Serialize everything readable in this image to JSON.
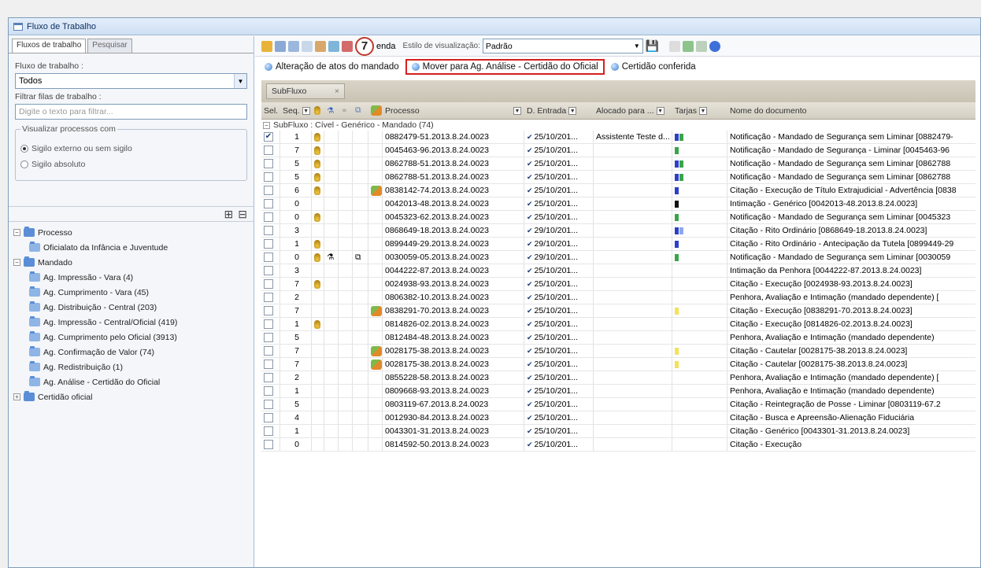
{
  "window": {
    "title": "Fluxo de Trabalho"
  },
  "left": {
    "tabs": [
      "Fluxos de trabalho",
      "Pesquisar"
    ],
    "fluxo_label": "Fluxo de trabalho :",
    "fluxo_value": "Todos",
    "filtrar_label": "Filtrar filas de trabalho :",
    "filtrar_placeholder": "Digite o texto para filtrar...",
    "visualizar_label": "Visualizar processos com",
    "radio_1": "Sigilo externo ou sem sigilo",
    "radio_2": "Sigilo absoluto",
    "tree": [
      {
        "label": "Processo",
        "level": 0,
        "expander": "−"
      },
      {
        "label": "Oficialato da Infância e Juventude",
        "level": 1
      },
      {
        "label": "Mandado",
        "level": 0,
        "expander": "−"
      },
      {
        "label": "Ag. Impressão - Vara (4)",
        "level": 1
      },
      {
        "label": "Ag. Cumprimento - Vara (45)",
        "level": 1
      },
      {
        "label": "Ag. Distribuição - Central (203)",
        "level": 1
      },
      {
        "label": "Ag. Impressão - Central/Oficial (419)",
        "level": 1
      },
      {
        "label": "Ag. Cumprimento pelo Oficial (3913)",
        "level": 1
      },
      {
        "label": "Ag. Confirmação de Valor (74)",
        "level": 1
      },
      {
        "label": "Ag. Redistribuição (1)",
        "level": 1
      },
      {
        "label": "Ag. Análise - Certidão do Oficial",
        "level": 1
      },
      {
        "label": "Certidão oficial",
        "level": 0,
        "expander": "+"
      }
    ]
  },
  "toolbar": {
    "step_badge": "7",
    "partial_label": "enda",
    "estilo_label": "Estilo de visualização:",
    "estilo_value": "Padrão"
  },
  "actions": [
    {
      "label": "Alteração de atos do mandado"
    },
    {
      "label": "Mover para Ag. Análise - Certidão do Oficial",
      "highlight": true
    },
    {
      "label": "Certidão conferida"
    }
  ],
  "subfluxo_chip": "SubFluxo",
  "columns": {
    "sel": "Sel.",
    "seq": "Seq.",
    "processo": "Processo",
    "entrada": "D. Entrada",
    "alocado": "Alocado para ...",
    "tarjas": "Tarjas",
    "documento": "Nome do documento"
  },
  "group_label": "SubFluxo : Cível - Genérico - Mandado (74)",
  "tag_colors": {
    "blue": "#2b3fc8",
    "green": "#3aa44a",
    "black": "#111111",
    "yellow": "#f3e25a",
    "lightblue": "#8da6f0"
  },
  "rows": [
    {
      "checked": true,
      "seq": "1",
      "bug": true,
      "processo": "0882479-51.2013.8.24.0023",
      "entrada": "25/10/201...",
      "alocado": "Assistente Teste d...",
      "tags": [
        "blue",
        "green"
      ],
      "doc": "Notificação - Mandado de Segurança sem Liminar [0882479-"
    },
    {
      "seq": "7",
      "bug": true,
      "processo": "0045463-96.2013.8.24.0023",
      "entrada": "25/10/201...",
      "tags": [
        "green"
      ],
      "doc": "Notificação - Mandado de Segurança - Liminar [0045463-96"
    },
    {
      "seq": "5",
      "bug": true,
      "processo": "0862788-51.2013.8.24.0023",
      "entrada": "25/10/201...",
      "tags": [
        "blue",
        "green"
      ],
      "doc": "Notificação - Mandado de Segurança sem Liminar [0862788"
    },
    {
      "seq": "5",
      "bug": true,
      "processo": "0862788-51.2013.8.24.0023",
      "entrada": "25/10/201...",
      "tags": [
        "blue",
        "green"
      ],
      "doc": "Notificação - Mandado de Segurança sem Liminar [0862788"
    },
    {
      "seq": "6",
      "bug": true,
      "big": true,
      "processo": "0838142-74.2013.8.24.0023",
      "entrada": "25/10/201...",
      "tags": [
        "blue"
      ],
      "doc": "Citação - Execução de Título Extrajudicial - Advertência [0838"
    },
    {
      "seq": "0",
      "processo": "0042013-48.2013.8.24.0023",
      "entrada": "25/10/201...",
      "tags": [
        "black"
      ],
      "doc": "Intimação - Genérico [0042013-48.2013.8.24.0023]"
    },
    {
      "seq": "0",
      "bug": true,
      "processo": "0045323-62.2013.8.24.0023",
      "entrada": "25/10/201...",
      "tags": [
        "green"
      ],
      "doc": "Notificação - Mandado de Segurança sem Liminar [0045323"
    },
    {
      "seq": "3",
      "processo": "0868649-18.2013.8.24.0023",
      "entrada": "29/10/201...",
      "tags": [
        "blue",
        "lightblue"
      ],
      "doc": "Citação - Rito Ordinário [0868649-18.2013.8.24.0023]"
    },
    {
      "seq": "1",
      "bug": true,
      "processo": "0899449-29.2013.8.24.0023",
      "entrada": "29/10/201...",
      "tags": [
        "blue"
      ],
      "doc": "Citação - Rito Ordinário - Antecipação da Tutela [0899449-29"
    },
    {
      "seq": "0",
      "bug": true,
      "flask": true,
      "pair": true,
      "processo": "0030059-05.2013.8.24.0023",
      "entrada": "29/10/201...",
      "tags": [
        "green"
      ],
      "doc": "Notificação - Mandado de Segurança sem Liminar [0030059"
    },
    {
      "seq": "3",
      "processo": "0044222-87.2013.8.24.0023",
      "entrada": "25/10/201...",
      "tags": [],
      "doc": "Intimação da Penhora [0044222-87.2013.8.24.0023]"
    },
    {
      "seq": "7",
      "bug": true,
      "processo": "0024938-93.2013.8.24.0023",
      "entrada": "25/10/201...",
      "tags": [],
      "doc": "Citação - Execução [0024938-93.2013.8.24.0023]"
    },
    {
      "seq": "2",
      "processo": "0806382-10.2013.8.24.0023",
      "entrada": "25/10/201...",
      "tags": [],
      "doc": "Penhora, Avaliação e Intimação (mandado dependente) ["
    },
    {
      "seq": "7",
      "big": true,
      "processo": "0838291-70.2013.8.24.0023",
      "entrada": "25/10/201...",
      "tags": [
        "yellow"
      ],
      "doc": "Citação - Execução [0838291-70.2013.8.24.0023]"
    },
    {
      "seq": "1",
      "bug": true,
      "processo": "0814826-02.2013.8.24.0023",
      "entrada": "25/10/201...",
      "tags": [],
      "doc": "Citação - Execução [0814826-02.2013.8.24.0023]"
    },
    {
      "seq": "5",
      "processo": "0812484-48.2013.8.24.0023",
      "entrada": "25/10/201...",
      "tags": [],
      "doc": "Penhora, Avaliação e Intimação (mandado dependente)"
    },
    {
      "seq": "7",
      "big": true,
      "processo": "0028175-38.2013.8.24.0023",
      "entrada": "25/10/201...",
      "tags": [
        "yellow"
      ],
      "doc": "Citação - Cautelar [0028175-38.2013.8.24.0023]"
    },
    {
      "seq": "7",
      "big": true,
      "processo": "0028175-38.2013.8.24.0023",
      "entrada": "25/10/201...",
      "tags": [
        "yellow"
      ],
      "doc": "Citação - Cautelar [0028175-38.2013.8.24.0023]"
    },
    {
      "seq": "2",
      "processo": "0855228-58.2013.8.24.0023",
      "entrada": "25/10/201...",
      "tags": [],
      "doc": "Penhora, Avaliação e Intimação (mandado dependente) ["
    },
    {
      "seq": "1",
      "processo": "0809668-93.2013.8.24.0023",
      "entrada": "25/10/201...",
      "tags": [],
      "doc": "Penhora, Avaliação e Intimação (mandado dependente)"
    },
    {
      "seq": "5",
      "processo": "0803119-67.2013.8.24.0023",
      "entrada": "25/10/201...",
      "tags": [],
      "doc": "Citação - Reintegração de Posse - Liminar [0803119-67.2"
    },
    {
      "seq": "4",
      "processo": "0012930-84.2013.8.24.0023",
      "entrada": "25/10/201...",
      "tags": [],
      "doc": "Citação - Busca e Apreensão-Alienação Fiduciária"
    },
    {
      "seq": "1",
      "processo": "0043301-31.2013.8.24.0023",
      "entrada": "25/10/201...",
      "tags": [],
      "doc": "Citação - Genérico [0043301-31.2013.8.24.0023]"
    },
    {
      "seq": "0",
      "processo": "0814592-50.2013.8.24.0023",
      "entrada": "25/10/201...",
      "tags": [],
      "doc": "Citação - Execução"
    }
  ]
}
